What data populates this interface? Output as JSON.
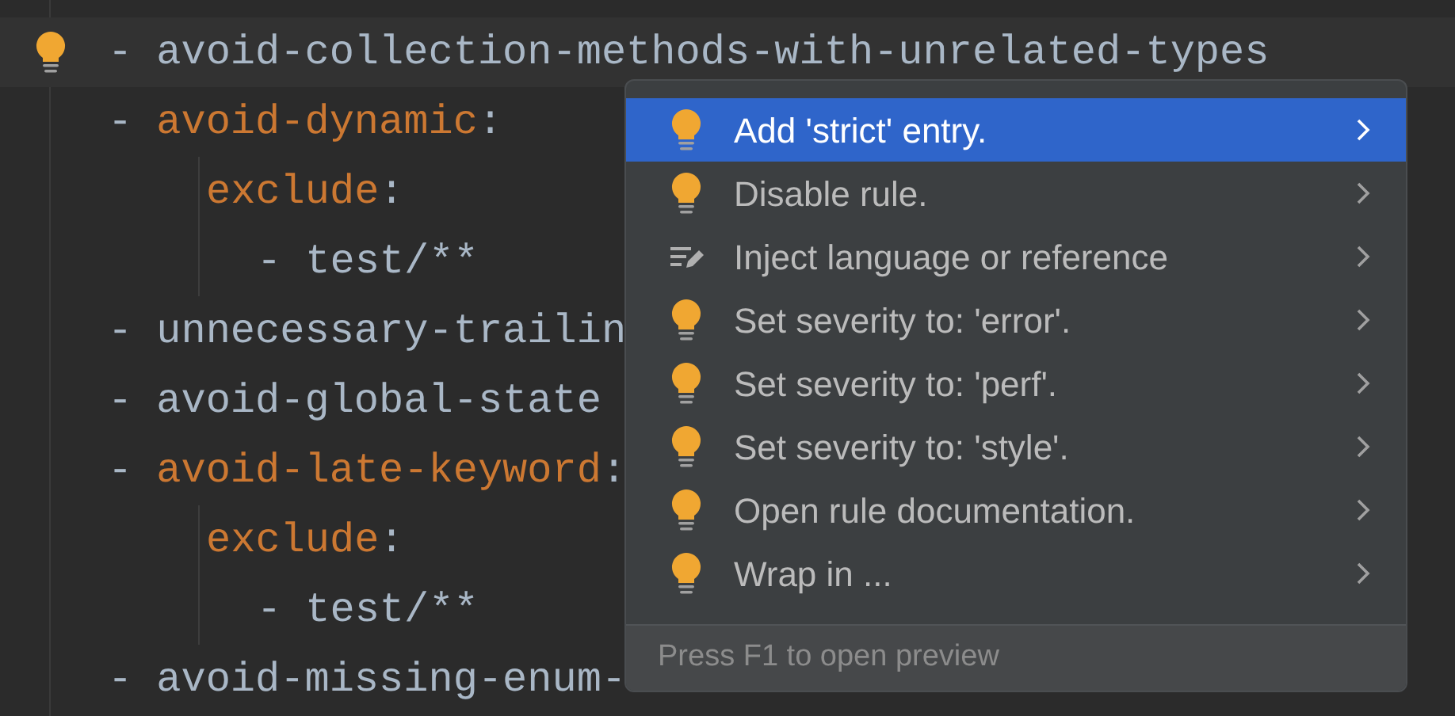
{
  "editor": {
    "lines": [
      {
        "marker": "-",
        "text": "avoid-collection-methods-with-unrelated-types",
        "kind": "item",
        "current": true
      },
      {
        "marker": "-",
        "text": "avoid-dynamic",
        "suffix": ":",
        "kind": "key",
        "current": false,
        "children": [
          {
            "text": "exclude",
            "suffix": ":",
            "kind": "key",
            "current": false,
            "children": [
              {
                "marker": "-",
                "text": "test/**",
                "kind": "item",
                "current": false
              }
            ]
          }
        ]
      },
      {
        "marker": "-",
        "text": "unnecessary-trailin",
        "kind": "item",
        "current": false
      },
      {
        "marker": "-",
        "text": "avoid-global-state",
        "kind": "item",
        "current": false
      },
      {
        "marker": "-",
        "text": "avoid-late-keyword",
        "suffix": ":",
        "kind": "key",
        "current": false,
        "children": [
          {
            "text": "exclude",
            "suffix": ":",
            "kind": "key",
            "current": false,
            "children": [
              {
                "marker": "-",
                "text": "test/**",
                "kind": "item",
                "current": false
              }
            ]
          }
        ]
      },
      {
        "marker": "-",
        "text": "avoid-missing-enum-",
        "kind": "item",
        "current": false
      }
    ]
  },
  "popup": {
    "items": [
      {
        "kind": "bulb",
        "label": "Add 'strict' entry.",
        "selected": true
      },
      {
        "kind": "bulb",
        "label": "Disable rule.",
        "selected": false
      },
      {
        "kind": "edit",
        "label": "Inject language or reference",
        "selected": false
      },
      {
        "kind": "bulb",
        "label": "Set severity to: 'error'.",
        "selected": false
      },
      {
        "kind": "bulb",
        "label": "Set severity to: 'perf'.",
        "selected": false
      },
      {
        "kind": "bulb",
        "label": "Set severity to: 'style'.",
        "selected": false
      },
      {
        "kind": "bulb",
        "label": "Open rule documentation.",
        "selected": false
      },
      {
        "kind": "bulb",
        "label": "Wrap in ...",
        "selected": false
      }
    ],
    "footer": "Press F1 to open preview"
  }
}
